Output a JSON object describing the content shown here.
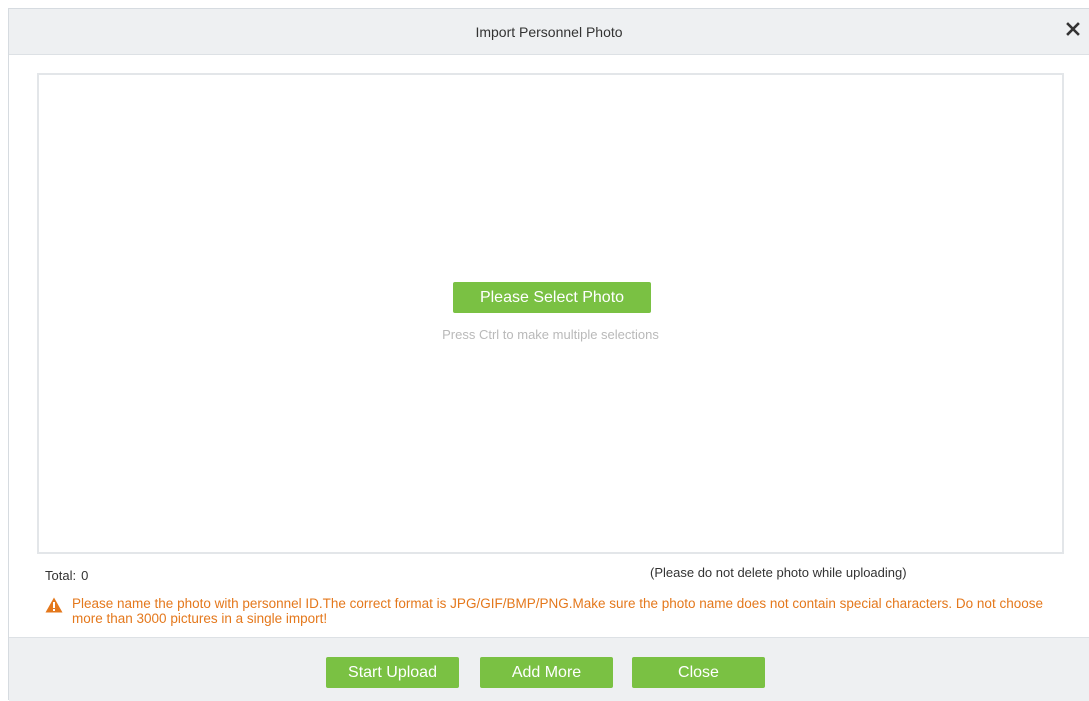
{
  "dialog": {
    "title": "Import Personnel Photo",
    "close_icon": "close-x-icon"
  },
  "dropzone": {
    "select_label": "Please Select Photo",
    "hint": "Press Ctrl to make multiple selections"
  },
  "status": {
    "total_label": "Total:",
    "total_value": "0",
    "no_delete_note": "(Please do not delete photo while uploading)"
  },
  "warning": {
    "icon": "warning-triangle-icon",
    "text": "Please name the photo with personnel ID.The correct format is JPG/GIF/BMP/PNG.Make sure the photo name does not contain special characters. Do not choose more than 3000 pictures in a single import!"
  },
  "footer": {
    "start_upload_label": "Start Upload",
    "add_more_label": "Add More",
    "close_label": "Close"
  },
  "colors": {
    "accent_green": "#7ac143",
    "warning_orange": "#e4781c",
    "header_bg": "#eef0f2"
  }
}
